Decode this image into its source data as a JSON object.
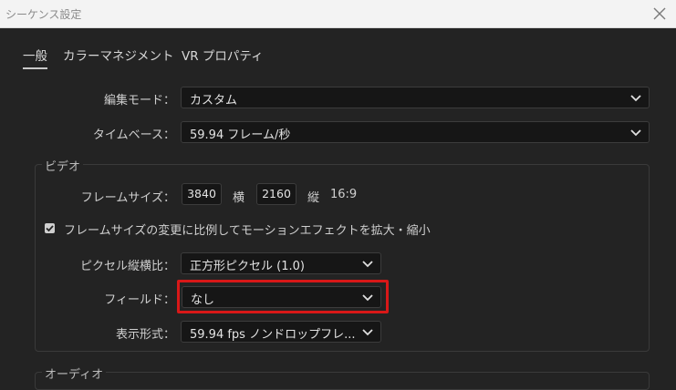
{
  "window": {
    "title": "シーケンス設定",
    "close_icon": "close-icon"
  },
  "tabs": [
    {
      "label": "一般",
      "active": true
    },
    {
      "label": "カラーマネジメント",
      "active": false
    },
    {
      "label": "VR プロパティ",
      "active": false
    }
  ],
  "general": {
    "edit_mode": {
      "label": "編集モード：",
      "value": "カスタム"
    },
    "timebase": {
      "label": "タイムベース：",
      "value": "59.94  フレーム/秒"
    }
  },
  "video": {
    "group_label": "ビデオ",
    "frame_size": {
      "label": "フレームサイズ：",
      "width": "3840",
      "width_label": "横",
      "height": "2160",
      "height_label": "縦",
      "aspect": "16:9"
    },
    "scale_checkbox": {
      "checked": true,
      "label": "フレームサイズの変更に比例してモーションエフェクトを拡大・縮小"
    },
    "pixel_aspect": {
      "label": "ピクセル縦横比：",
      "value": "正方形ピクセル (1.0)"
    },
    "fields": {
      "label": "フィールド：",
      "value": "なし"
    },
    "display_format": {
      "label": "表示形式：",
      "value": "59.94 fps ノンドロップフレ..."
    }
  },
  "audio": {
    "group_label": "オーディオ"
  },
  "colors": {
    "highlight": "#d81818",
    "background": "#232323",
    "titlebar": "#f3f3f3"
  }
}
